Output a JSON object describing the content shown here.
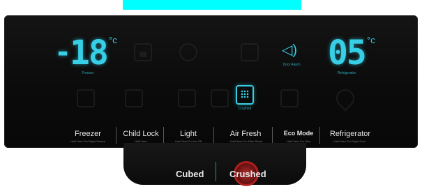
{
  "banner": {
    "text": ""
  },
  "freezer": {
    "sign": "-",
    "value": "18",
    "unit": "°c",
    "caption": "Freezer"
  },
  "refrigerator": {
    "value": "05",
    "unit": "°c",
    "caption": "Refrigerator"
  },
  "alarm": {
    "caption": "Door Alarm"
  },
  "dispenser_icon": {
    "caption": "Crushed"
  },
  "buttons": [
    {
      "label": "Freezer",
      "sub": "Hold 3sec For Rapid Freeze"
    },
    {
      "label": "Child Lock",
      "sub": "Hold 3sec"
    },
    {
      "label": "Light",
      "sub": "Hold 3sec For Ice Off"
    },
    {
      "label": "Air Fresh",
      "sub": "Hold 3sec For Filter Reset"
    },
    {
      "label": "Eco Mode",
      "sub": "Hold 3sec For Max"
    },
    {
      "label": "Refrigerator",
      "sub": "Hold 3sec For Rapid Cool"
    }
  ],
  "ice": {
    "cubed": "Cubed",
    "crushed": "Crushed"
  },
  "colors": {
    "accent": "#36cfe6",
    "panel": "#0b0b0b",
    "highlight": "#c02020"
  },
  "icons": [
    "lock-icon",
    "bulb-icon",
    "filter-icon",
    "speaker-icon",
    "cube-icon",
    "child-lock-icon",
    "ice-maker-icon",
    "ice-tray-icon",
    "crushed-ice-icon",
    "eco-icon",
    "water-drop-icon"
  ]
}
